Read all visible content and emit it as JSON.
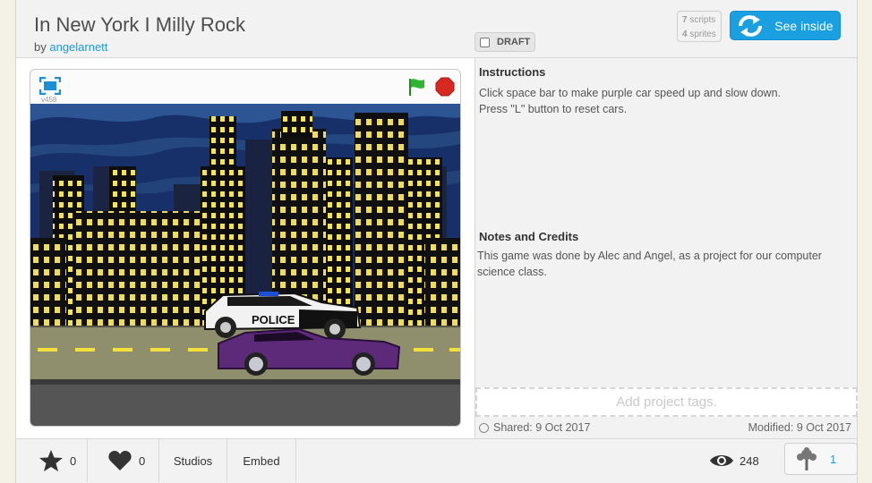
{
  "project": {
    "title": "In New York I Milly Rock",
    "by": "by",
    "author": "angelarnett"
  },
  "draft_label": "DRAFT",
  "counts": {
    "scripts_num": "7",
    "scripts_label": "scripts",
    "sprites_num": "4",
    "sprites_label": "sprites"
  },
  "see_inside_label": "See inside",
  "player": {
    "version": "v458"
  },
  "stage": {
    "police_text": "POLICE"
  },
  "instructions": {
    "heading": "Instructions",
    "line1": "Click space bar to make purple car speed up and slow down.",
    "line2": "Press \"L\" button to reset cars."
  },
  "notes": {
    "heading": "Notes and Credits",
    "text": "This game was done by Alec and Angel, as a project for our computer science class."
  },
  "tags_placeholder": "Add project tags.",
  "shared": "Shared: 9 Oct 2017",
  "modified": "Modified: 9 Oct 2017",
  "footer": {
    "favorites": "0",
    "loves": "0",
    "studios": "Studios",
    "embed": "Embed",
    "views": "248",
    "remixes": "1"
  },
  "colors": {
    "accent": "#1aa0e0",
    "link": "#1d9ad6",
    "stop": "#d9281f",
    "flag": "#2fb52f",
    "sky": "#17306a",
    "road": "#8f8f6e",
    "car": "#5d2a7a"
  },
  "icons": [
    "fullscreen-icon",
    "green-flag-icon",
    "stop-icon",
    "remix-arrows-icon",
    "star-icon",
    "heart-icon",
    "eye-icon",
    "remix-tree-icon",
    "shared-icon"
  ]
}
